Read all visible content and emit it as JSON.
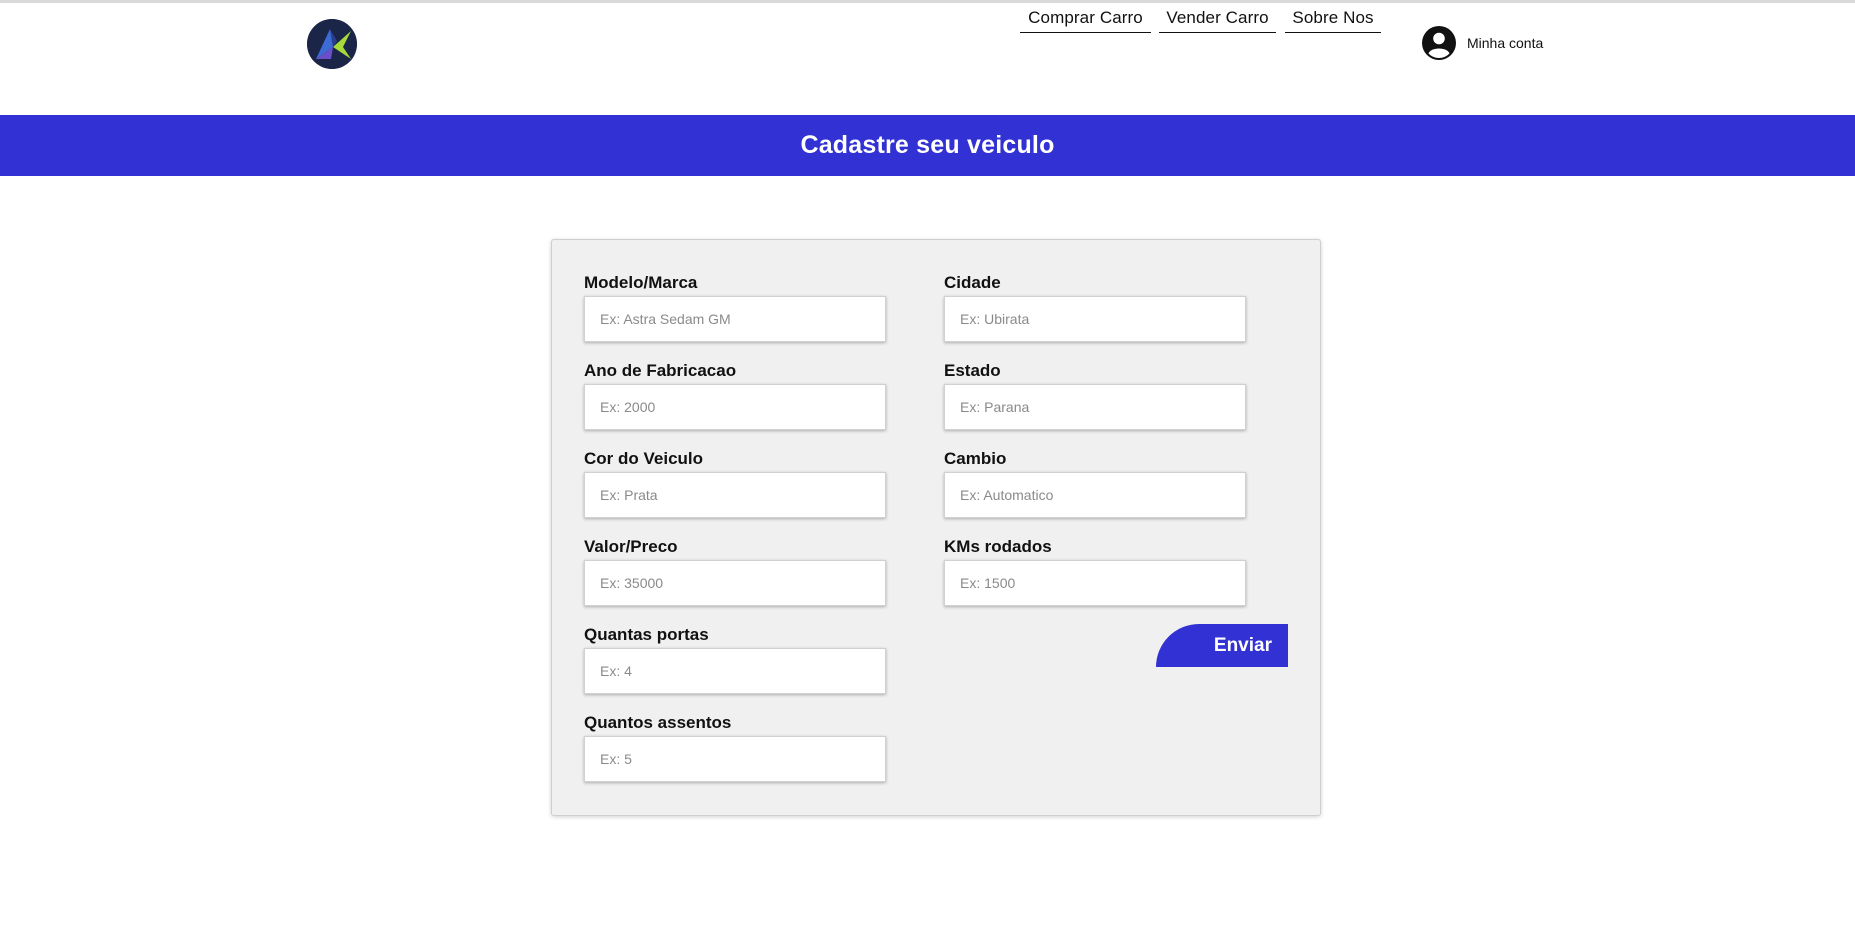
{
  "header": {
    "logo": "logo-icon",
    "nav": [
      {
        "label": "Comprar Carro"
      },
      {
        "label": "Vender Carro"
      },
      {
        "label": "Sobre Nos"
      }
    ],
    "account": {
      "icon": "user-circle-icon",
      "label": "Minha conta"
    }
  },
  "banner": {
    "title": "Cadastre seu veiculo"
  },
  "form": {
    "left": [
      {
        "label": "Modelo/Marca",
        "placeholder": "Ex: Astra Sedam GM",
        "value": ""
      },
      {
        "label": "Ano de Fabricacao",
        "placeholder": "Ex: 2000",
        "value": ""
      },
      {
        "label": "Cor do Veiculo",
        "placeholder": "Ex: Prata",
        "value": ""
      },
      {
        "label": "Valor/Preco",
        "placeholder": "Ex: 35000",
        "value": ""
      },
      {
        "label": "Quantas portas",
        "placeholder": "Ex: 4",
        "value": ""
      },
      {
        "label": "Quantos assentos",
        "placeholder": "Ex: 5",
        "value": ""
      }
    ],
    "right": [
      {
        "label": "Cidade",
        "placeholder": "Ex: Ubirata",
        "value": ""
      },
      {
        "label": "Estado",
        "placeholder": "Ex: Parana",
        "value": ""
      },
      {
        "label": "Cambio",
        "placeholder": "Ex: Automatico",
        "value": ""
      },
      {
        "label": "KMs rodados",
        "placeholder": "Ex: 1500",
        "value": ""
      }
    ],
    "submit_label": "Enviar"
  },
  "colors": {
    "accent": "#3232d4",
    "card": "#f0f0f0",
    "logo_bg": "#1a2548"
  }
}
